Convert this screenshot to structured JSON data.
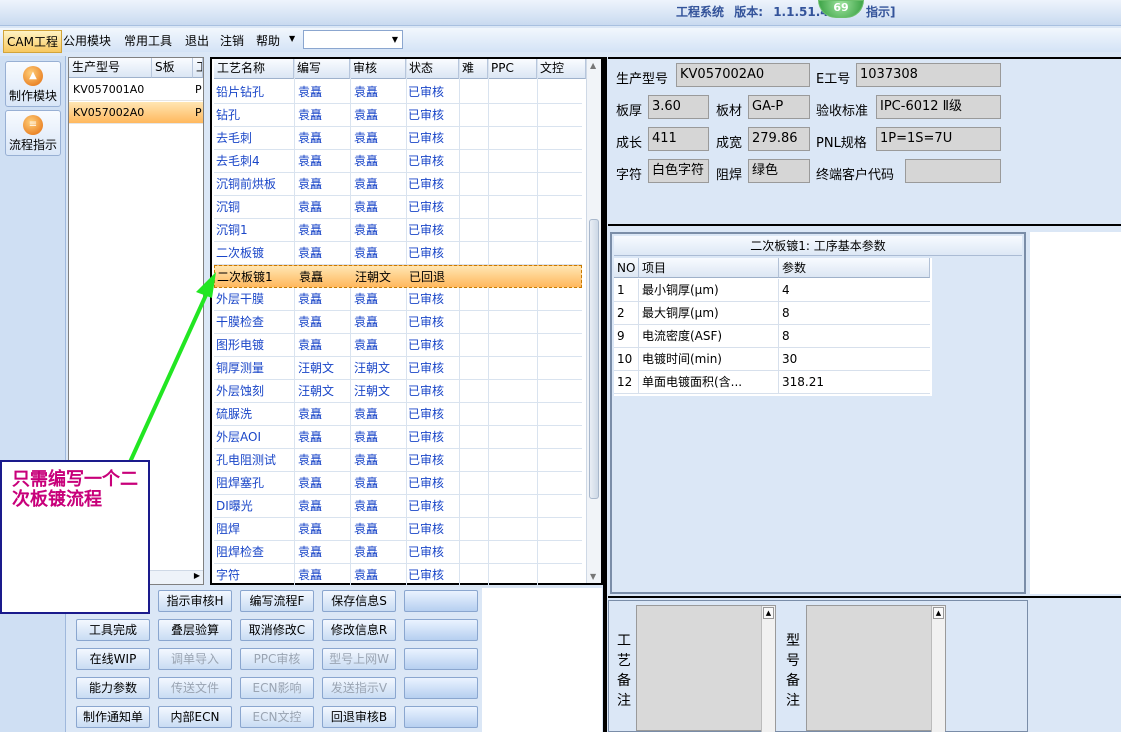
{
  "header": {
    "system": "工程系统",
    "version_label": "版本:",
    "version": "1.1.51.4",
    "badge": "69",
    "hint": "指示]"
  },
  "menu": {
    "items": [
      "CAM工程",
      "公用模块",
      "常用工具",
      "退出",
      "注销",
      "帮助"
    ],
    "combo_value": ""
  },
  "rail": {
    "buttons": [
      {
        "label": "制作模块",
        "icon": "fire-icon"
      },
      {
        "label": "流程指示",
        "icon": "flow-icon"
      }
    ]
  },
  "product_list": {
    "headers": [
      "生产型号",
      "S板",
      "工"
    ],
    "rows": [
      {
        "code": "KV057001A0",
        "s": "P"
      },
      {
        "code": "KV057002A0",
        "s": "P"
      }
    ],
    "selected_index": 1
  },
  "process_grid": {
    "headers": [
      "工艺名称",
      "编写",
      "审核",
      "状态",
      "难",
      "PPC",
      "文控"
    ],
    "rows": [
      [
        "铅片钻孔",
        "袁矗",
        "袁矗",
        "已审核"
      ],
      [
        "钻孔",
        "袁矗",
        "袁矗",
        "已审核"
      ],
      [
        "去毛刺",
        "袁矗",
        "袁矗",
        "已审核"
      ],
      [
        "去毛刺4",
        "袁矗",
        "袁矗",
        "已审核"
      ],
      [
        "沉铜前烘板",
        "袁矗",
        "袁矗",
        "已审核"
      ],
      [
        "沉铜",
        "袁矗",
        "袁矗",
        "已审核"
      ],
      [
        "沉铜1",
        "袁矗",
        "袁矗",
        "已审核"
      ],
      [
        "二次板镀",
        "袁矗",
        "袁矗",
        "已审核"
      ],
      [
        "二次板镀1",
        "袁矗",
        "汪朝文",
        "已回退"
      ],
      [
        "外层干膜",
        "袁矗",
        "袁矗",
        "已审核"
      ],
      [
        "干膜检查",
        "袁矗",
        "袁矗",
        "已审核"
      ],
      [
        "图形电镀",
        "袁矗",
        "袁矗",
        "已审核"
      ],
      [
        "铜厚测量",
        "汪朝文",
        "汪朝文",
        "已审核"
      ],
      [
        "外层蚀刻",
        "汪朝文",
        "汪朝文",
        "已审核"
      ],
      [
        "硫脲洗",
        "袁矗",
        "袁矗",
        "已审核"
      ],
      [
        "外层AOI",
        "袁矗",
        "袁矗",
        "已审核"
      ],
      [
        "孔电阻测试",
        "袁矗",
        "袁矗",
        "已审核"
      ],
      [
        "阻焊塞孔",
        "袁矗",
        "袁矗",
        "已审核"
      ],
      [
        "DI曝光",
        "袁矗",
        "袁矗",
        "已审核"
      ],
      [
        "阻焊",
        "袁矗",
        "袁矗",
        "已审核"
      ],
      [
        "阻焊检查",
        "袁矗",
        "袁矗",
        "已审核"
      ],
      [
        "字符",
        "袁矗",
        "袁矗",
        "已审核"
      ]
    ],
    "selected_index": 8
  },
  "buttons": [
    [
      "",
      "指示审核H",
      "编写流程F",
      "保存信息S",
      ""
    ],
    [
      "工具完成",
      "叠层验算",
      "取消修改C",
      "修改信息R",
      ""
    ],
    [
      "在线WIP",
      "调单导入",
      "PPC审核",
      "型号上网W",
      ""
    ],
    [
      "能力参数",
      "传送文件",
      "ECN影响",
      "发送指示V",
      ""
    ],
    [
      "制作通知单",
      "内部ECN",
      "ECN文控",
      "回退审核B",
      ""
    ]
  ],
  "disabled_buttons": [
    "调单导入",
    "PPC审核",
    "型号上网W",
    "传送文件",
    "ECN影响",
    "发送指示V",
    "ECN文控"
  ],
  "info": {
    "prod_label": "生产型号",
    "prod": "KV057002A0",
    "eno_label": "E工号",
    "eno": "1037308",
    "thick_label": "板厚",
    "thick": "3.60",
    "material_label": "板材",
    "material": "GA-P",
    "std_label": "验收标准",
    "std": "IPC-6012 Ⅱ级",
    "len_label": "成长",
    "len": "411",
    "width_label": "成宽",
    "width": "279.86",
    "pnl_label": "PNL规格",
    "pnl": "1P=1S=7U",
    "char_label": "字符",
    "char": "白色字符",
    "mask_label": "阻焊",
    "mask": "绿色",
    "cust_label": "终端客户代码",
    "cust": ""
  },
  "params": {
    "title": "二次板镀1: 工序基本参数",
    "headers": [
      "NO",
      "项目",
      "参数"
    ],
    "rows": [
      [
        "1",
        "最小铜厚(μm)",
        "4"
      ],
      [
        "2",
        "最大铜厚(μm)",
        "8"
      ],
      [
        "9",
        "电流密度(ASF)",
        "8"
      ],
      [
        "10",
        "电镀时间(min)",
        "30"
      ],
      [
        "12",
        "单面电镀面积(含...",
        "318.21"
      ]
    ]
  },
  "notes": {
    "process_label": [
      "工",
      "艺",
      "备",
      "注"
    ],
    "model_label": [
      "型",
      "号",
      "备",
      "注"
    ]
  },
  "annotation": {
    "text": "只需编写一个二次板镀流程",
    "arrow_color": "#22e622",
    "text_color": "#c8007a"
  }
}
